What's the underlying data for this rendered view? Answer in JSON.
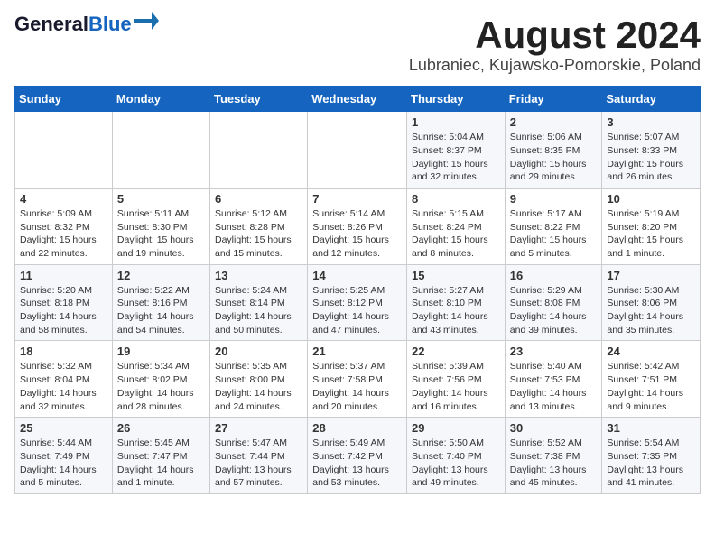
{
  "logo": {
    "line1": "General",
    "line2": "Blue"
  },
  "title": "August 2024",
  "subtitle": "Lubraniec, Kujawsko-Pomorskie, Poland",
  "days_of_week": [
    "Sunday",
    "Monday",
    "Tuesday",
    "Wednesday",
    "Thursday",
    "Friday",
    "Saturday"
  ],
  "weeks": [
    [
      {
        "day": "",
        "info": ""
      },
      {
        "day": "",
        "info": ""
      },
      {
        "day": "",
        "info": ""
      },
      {
        "day": "",
        "info": ""
      },
      {
        "day": "1",
        "info": "Sunrise: 5:04 AM\nSunset: 8:37 PM\nDaylight: 15 hours\nand 32 minutes."
      },
      {
        "day": "2",
        "info": "Sunrise: 5:06 AM\nSunset: 8:35 PM\nDaylight: 15 hours\nand 29 minutes."
      },
      {
        "day": "3",
        "info": "Sunrise: 5:07 AM\nSunset: 8:33 PM\nDaylight: 15 hours\nand 26 minutes."
      }
    ],
    [
      {
        "day": "4",
        "info": "Sunrise: 5:09 AM\nSunset: 8:32 PM\nDaylight: 15 hours\nand 22 minutes."
      },
      {
        "day": "5",
        "info": "Sunrise: 5:11 AM\nSunset: 8:30 PM\nDaylight: 15 hours\nand 19 minutes."
      },
      {
        "day": "6",
        "info": "Sunrise: 5:12 AM\nSunset: 8:28 PM\nDaylight: 15 hours\nand 15 minutes."
      },
      {
        "day": "7",
        "info": "Sunrise: 5:14 AM\nSunset: 8:26 PM\nDaylight: 15 hours\nand 12 minutes."
      },
      {
        "day": "8",
        "info": "Sunrise: 5:15 AM\nSunset: 8:24 PM\nDaylight: 15 hours\nand 8 minutes."
      },
      {
        "day": "9",
        "info": "Sunrise: 5:17 AM\nSunset: 8:22 PM\nDaylight: 15 hours\nand 5 minutes."
      },
      {
        "day": "10",
        "info": "Sunrise: 5:19 AM\nSunset: 8:20 PM\nDaylight: 15 hours\nand 1 minute."
      }
    ],
    [
      {
        "day": "11",
        "info": "Sunrise: 5:20 AM\nSunset: 8:18 PM\nDaylight: 14 hours\nand 58 minutes."
      },
      {
        "day": "12",
        "info": "Sunrise: 5:22 AM\nSunset: 8:16 PM\nDaylight: 14 hours\nand 54 minutes."
      },
      {
        "day": "13",
        "info": "Sunrise: 5:24 AM\nSunset: 8:14 PM\nDaylight: 14 hours\nand 50 minutes."
      },
      {
        "day": "14",
        "info": "Sunrise: 5:25 AM\nSunset: 8:12 PM\nDaylight: 14 hours\nand 47 minutes."
      },
      {
        "day": "15",
        "info": "Sunrise: 5:27 AM\nSunset: 8:10 PM\nDaylight: 14 hours\nand 43 minutes."
      },
      {
        "day": "16",
        "info": "Sunrise: 5:29 AM\nSunset: 8:08 PM\nDaylight: 14 hours\nand 39 minutes."
      },
      {
        "day": "17",
        "info": "Sunrise: 5:30 AM\nSunset: 8:06 PM\nDaylight: 14 hours\nand 35 minutes."
      }
    ],
    [
      {
        "day": "18",
        "info": "Sunrise: 5:32 AM\nSunset: 8:04 PM\nDaylight: 14 hours\nand 32 minutes."
      },
      {
        "day": "19",
        "info": "Sunrise: 5:34 AM\nSunset: 8:02 PM\nDaylight: 14 hours\nand 28 minutes."
      },
      {
        "day": "20",
        "info": "Sunrise: 5:35 AM\nSunset: 8:00 PM\nDaylight: 14 hours\nand 24 minutes."
      },
      {
        "day": "21",
        "info": "Sunrise: 5:37 AM\nSunset: 7:58 PM\nDaylight: 14 hours\nand 20 minutes."
      },
      {
        "day": "22",
        "info": "Sunrise: 5:39 AM\nSunset: 7:56 PM\nDaylight: 14 hours\nand 16 minutes."
      },
      {
        "day": "23",
        "info": "Sunrise: 5:40 AM\nSunset: 7:53 PM\nDaylight: 14 hours\nand 13 minutes."
      },
      {
        "day": "24",
        "info": "Sunrise: 5:42 AM\nSunset: 7:51 PM\nDaylight: 14 hours\nand 9 minutes."
      }
    ],
    [
      {
        "day": "25",
        "info": "Sunrise: 5:44 AM\nSunset: 7:49 PM\nDaylight: 14 hours\nand 5 minutes."
      },
      {
        "day": "26",
        "info": "Sunrise: 5:45 AM\nSunset: 7:47 PM\nDaylight: 14 hours\nand 1 minute."
      },
      {
        "day": "27",
        "info": "Sunrise: 5:47 AM\nSunset: 7:44 PM\nDaylight: 13 hours\nand 57 minutes."
      },
      {
        "day": "28",
        "info": "Sunrise: 5:49 AM\nSunset: 7:42 PM\nDaylight: 13 hours\nand 53 minutes."
      },
      {
        "day": "29",
        "info": "Sunrise: 5:50 AM\nSunset: 7:40 PM\nDaylight: 13 hours\nand 49 minutes."
      },
      {
        "day": "30",
        "info": "Sunrise: 5:52 AM\nSunset: 7:38 PM\nDaylight: 13 hours\nand 45 minutes."
      },
      {
        "day": "31",
        "info": "Sunrise: 5:54 AM\nSunset: 7:35 PM\nDaylight: 13 hours\nand 41 minutes."
      }
    ]
  ]
}
